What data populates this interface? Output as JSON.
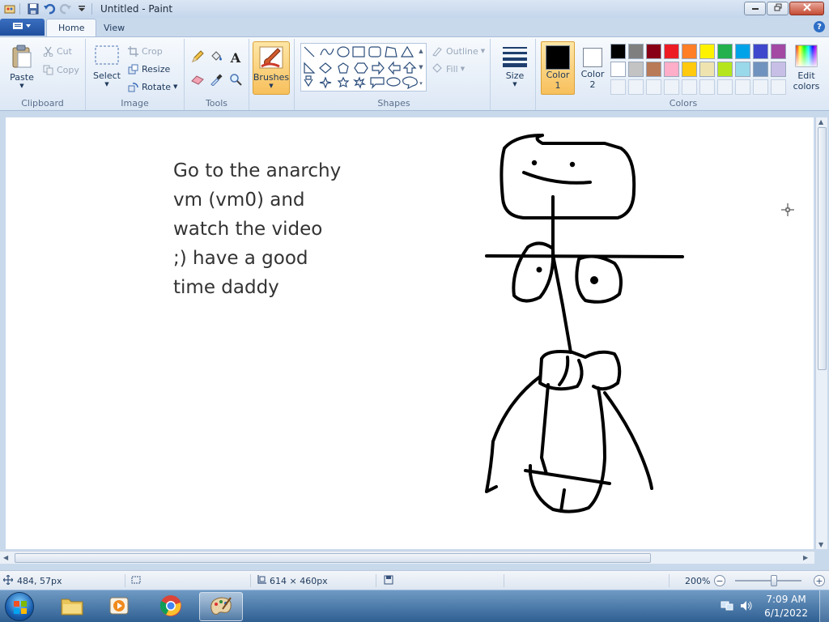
{
  "window": {
    "title": "Untitled - Paint",
    "minimize_icon": "minimize-icon",
    "maximize_icon": "restore-icon",
    "close_icon": "close-icon"
  },
  "tabs": [
    {
      "label": "Home",
      "active": true
    },
    {
      "label": "View",
      "active": false
    }
  ],
  "ribbon": {
    "clipboard": {
      "label": "Clipboard",
      "paste": "Paste",
      "cut": "Cut",
      "copy": "Copy"
    },
    "image": {
      "label": "Image",
      "select": "Select",
      "crop": "Crop",
      "resize": "Resize",
      "rotate": "Rotate"
    },
    "tools": {
      "label": "Tools"
    },
    "brushes": {
      "label": "Brushes"
    },
    "shapes": {
      "label": "Shapes",
      "outline": "Outline",
      "fill": "Fill"
    },
    "size": {
      "label": "Size"
    },
    "colors": {
      "label": "Colors",
      "color1_label": "Color",
      "color1_num": "1",
      "color2_label": "Color",
      "color2_num": "2",
      "edit_colors_line1": "Edit",
      "edit_colors_line2": "colors",
      "color1_value": "#000000",
      "color2_value": "#ffffff",
      "palette_row1": [
        "#000000",
        "#7f7f7f",
        "#880015",
        "#ed1c24",
        "#ff7f27",
        "#fff200",
        "#22b14c",
        "#00a2e8",
        "#3f48cc",
        "#a349a4"
      ],
      "palette_row2": [
        "#ffffff",
        "#c3c3c3",
        "#b97a57",
        "#ffaec9",
        "#ffc90e",
        "#efe4b0",
        "#b5e61d",
        "#99d9ea",
        "#7092be",
        "#c8bfe7"
      ]
    }
  },
  "canvas_text": {
    "line1": "Go to the anarchy",
    "line2": "vm (vm0) and",
    "line3": "watch the video",
    "line4": ";) have a good",
    "line5": "time daddy"
  },
  "statusbar": {
    "cursor_pos": "484, 57px",
    "image_size": "614 × 460px",
    "zoom": "200%"
  },
  "taskbar": {
    "time": "7:09 AM",
    "date": "6/1/2022"
  }
}
